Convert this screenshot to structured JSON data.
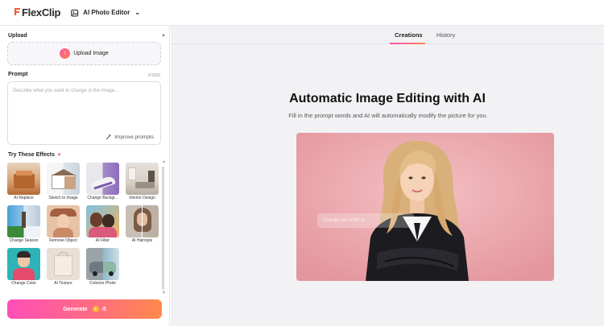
{
  "app": {
    "brand": "FlexClip",
    "tool_name": "AI Photo Editor"
  },
  "left": {
    "upload_title": "Upload",
    "upload_button": "Upload Image",
    "prompt_title": "Prompt",
    "prompt_counter": "0/1000",
    "prompt_placeholder": "Describe what you want to change in the image...",
    "improve_label": "Improve prompts",
    "effects_title": "Try These Effects",
    "effects": [
      {
        "label": "AI Replace"
      },
      {
        "label": "Sketch to Image"
      },
      {
        "label": "Change Backgr..."
      },
      {
        "label": "Interior Design"
      },
      {
        "label": "Change Season"
      },
      {
        "label": "Remove Object"
      },
      {
        "label": "AI Filter"
      },
      {
        "label": "AI Hairstyle"
      },
      {
        "label": "Change Color"
      },
      {
        "label": "AI Texture"
      },
      {
        "label": "Colorize Photo"
      }
    ],
    "generate_label": "Generate",
    "generate_cost": "-5"
  },
  "main": {
    "tabs": [
      {
        "label": "Creations"
      },
      {
        "label": "History"
      }
    ],
    "active_tab": "Creations",
    "headline": "Automatic Image Editing with AI",
    "subline": "Fill in the prompt words and AI will automatically modify the picture for you",
    "overlay_text": "Change her outfit to"
  },
  "colors": {
    "accent_gradient_start": "#ff4fb8",
    "accent_gradient_end": "#ff8a4a",
    "preview_bg": "#e8a4aa"
  }
}
